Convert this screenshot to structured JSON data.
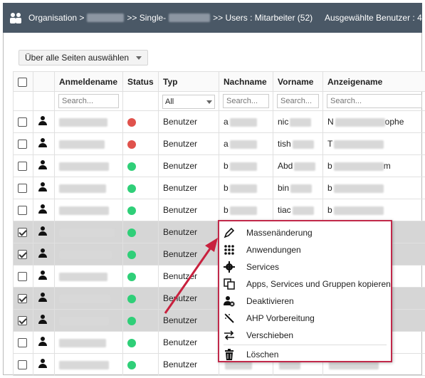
{
  "breadcrumb": {
    "org_label": "Organisation >",
    "sep1": ">> Single-",
    "users_label": ">> Users : Mitarbeiter (52)",
    "selected_users": "Ausgewählte Benutzer : 4"
  },
  "toolbar": {
    "select_all_pages": "Über alle Seiten auswählen"
  },
  "table": {
    "columns": [
      "Anmeldename",
      "Status",
      "Typ",
      "Nachname",
      "Vorname",
      "Anzeigename"
    ],
    "filter_placeholder": "Search...",
    "type_filter_value": "All",
    "rows": [
      {
        "status": "red",
        "typ": "Benutzer",
        "selected": false,
        "nach": "a",
        "vor": "nic",
        "anz": "N",
        "anz_tail": "ophe"
      },
      {
        "status": "red",
        "typ": "Benutzer",
        "selected": false,
        "nach": "a",
        "vor": "tish",
        "anz": "T",
        "anz_tail": ""
      },
      {
        "status": "green",
        "typ": "Benutzer",
        "selected": false,
        "nach": "b",
        "vor": "Abd",
        "anz": "b",
        "anz_tail": "m"
      },
      {
        "status": "green",
        "typ": "Benutzer",
        "selected": false,
        "nach": "b",
        "vor": "bin",
        "anz": "b",
        "anz_tail": ""
      },
      {
        "status": "green",
        "typ": "Benutzer",
        "selected": false,
        "nach": "b",
        "vor": "tiac",
        "anz": "b",
        "anz_tail": ""
      },
      {
        "status": "green",
        "typ": "Benutzer",
        "selected": true,
        "nach": "",
        "vor": "",
        "anz": "",
        "anz_tail": "d"
      },
      {
        "status": "green",
        "typ": "Benutzer",
        "selected": true,
        "nach": "",
        "vor": "",
        "anz": "",
        "anz_tail": ""
      },
      {
        "status": "green",
        "typ": "Benutzer",
        "selected": false,
        "nach": "",
        "vor": "",
        "anz": "",
        "anz_tail": "na"
      },
      {
        "status": "green",
        "typ": "Benutzer",
        "selected": true,
        "nach": "",
        "vor": "",
        "anz": "",
        "anz_tail": "uo"
      },
      {
        "status": "green",
        "typ": "Benutzer",
        "selected": true,
        "nach": "",
        "vor": "",
        "anz": "",
        "anz_tail": ""
      },
      {
        "status": "green",
        "typ": "Benutzer",
        "selected": false,
        "nach": "",
        "vor": "",
        "anz": "",
        "anz_tail": ""
      },
      {
        "status": "green",
        "typ": "Benutzer",
        "selected": false,
        "nach": "",
        "vor": "",
        "anz": "",
        "anz_tail": ""
      }
    ]
  },
  "context_menu": {
    "items": [
      {
        "label": "Massenänderung",
        "icon": "pencil-icon"
      },
      {
        "label": "Anwendungen",
        "icon": "grid-icon"
      },
      {
        "label": "Services",
        "icon": "gear-icon"
      },
      {
        "label": "Apps, Services und Gruppen kopieren",
        "icon": "copy-icon"
      },
      {
        "label": "Deaktivieren",
        "icon": "user-disable-icon"
      },
      {
        "label": "AHP Vorbereitung",
        "icon": "magic-wand-icon"
      },
      {
        "label": "Verschieben",
        "icon": "swap-arrows-icon"
      },
      {
        "label": "Löschen",
        "icon": "trash-icon"
      }
    ]
  },
  "colors": {
    "topbar": "#4a5866",
    "menu_border": "#c1294a",
    "arrow": "#c8213e",
    "status_red": "#e0524c",
    "status_green": "#2fcf78"
  }
}
